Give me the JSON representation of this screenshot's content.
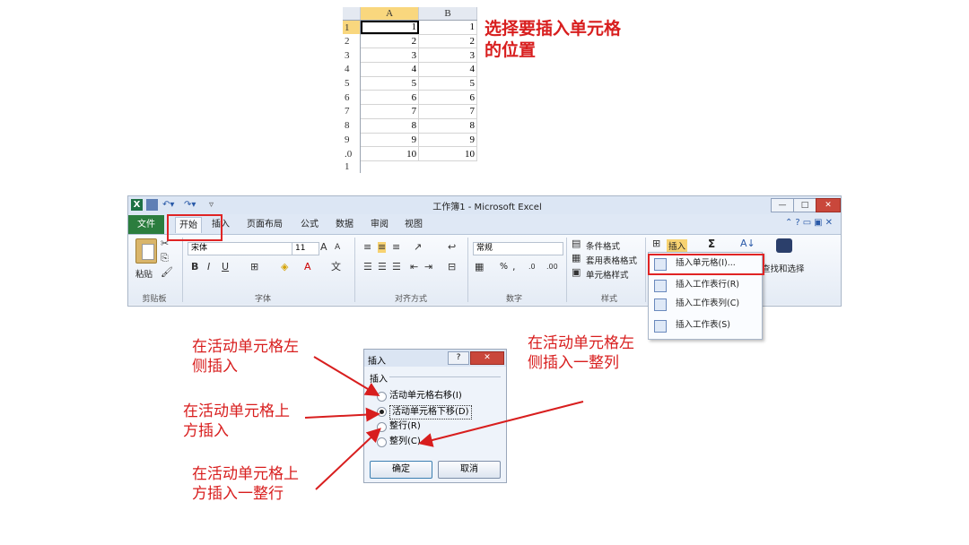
{
  "sheet": {
    "col_headers": [
      "A",
      "B"
    ],
    "rows": [
      {
        "n": "1",
        "a": "1",
        "b": "1"
      },
      {
        "n": "2",
        "a": "2",
        "b": "2"
      },
      {
        "n": "3",
        "a": "3",
        "b": "3"
      },
      {
        "n": "4",
        "a": "4",
        "b": "4"
      },
      {
        "n": "5",
        "a": "5",
        "b": "5"
      },
      {
        "n": "6",
        "a": "6",
        "b": "6"
      },
      {
        "n": "7",
        "a": "7",
        "b": "7"
      },
      {
        "n": "8",
        "a": "8",
        "b": "8"
      },
      {
        "n": "9",
        "a": "9",
        "b": "9"
      },
      {
        "n": ".0",
        "a": "10",
        "b": "10"
      },
      {
        "n": "1",
        "a": "",
        "b": ""
      }
    ],
    "note": "选择要插入单元格的位置"
  },
  "excel": {
    "title": "工作簿1 - Microsoft Excel",
    "window_buttons": {
      "min": "—",
      "max": "□",
      "close": "✕"
    },
    "tabs": [
      "文件",
      "开始",
      "插入",
      "页面布局",
      "公式",
      "数据",
      "审阅",
      "视图"
    ],
    "ribbon": {
      "clipboard": {
        "paste": "粘贴",
        "label": "剪贴板"
      },
      "font": {
        "name": "宋体",
        "size": "11",
        "label": "字体",
        "bold": "B",
        "italic": "I",
        "underline": "U"
      },
      "alignment": {
        "label": "对齐方式"
      },
      "number": {
        "format": "常规",
        "label": "数字",
        "percent": "%"
      },
      "styles": {
        "cond": "条件格式",
        "table": "套用表格格式",
        "cell": "单元格样式",
        "label": "样式"
      },
      "cells": {
        "insert": "插入"
      },
      "editing": {
        "sum": "Σ",
        "find": "查找和选择"
      }
    },
    "insert_menu": [
      "插入单元格(I)...",
      "插入工作表行(R)",
      "插入工作表列(C)",
      "插入工作表(S)"
    ]
  },
  "dialog": {
    "title": "插入",
    "help": "?",
    "close": "✕",
    "group": "插入",
    "options": [
      "活动单元格右移(I)",
      "活动单元格下移(D)",
      "整行(R)",
      "整列(C)"
    ],
    "selected_index": 1,
    "ok": "确定",
    "cancel": "取消"
  },
  "annotations": {
    "a1": "在活动单元格左侧插入",
    "a2": "在活动单元格上方插入",
    "a3": "在活动单元格上方插入一整行",
    "a4": "在活动单元格左侧插入一整列"
  },
  "colors": {
    "annotation_red": "#d81e1e",
    "file_tab": "#2b7d3e",
    "active_header": "#f9d77e"
  }
}
